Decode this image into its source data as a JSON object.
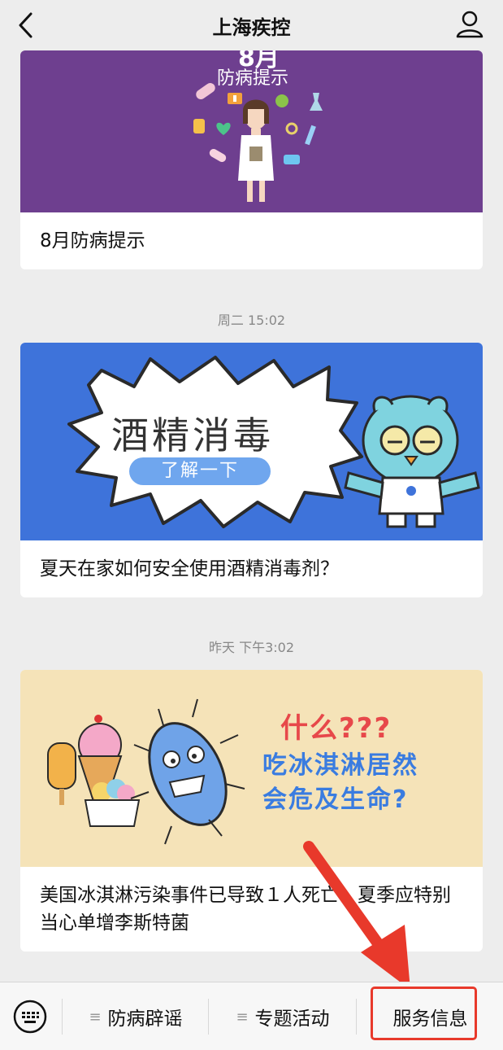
{
  "header": {
    "title": "上海疾控",
    "back_icon": "chevron-left-icon",
    "user_icon": "user-icon"
  },
  "feed": {
    "items": [
      {
        "cover_top_text": "8月",
        "cover_text": "防病提示",
        "cover_color": "#6e3f8f",
        "caption": "8月防病提示"
      },
      {
        "time": "周二 15:02",
        "cover_title": "酒精消毒",
        "cover_button": "了解一下",
        "cover_color": "#3e73da",
        "caption": "夏天在家如何安全使用酒精消毒剂？"
      },
      {
        "time": "昨天 下午3:02",
        "cover_line1": "什么???",
        "cover_line2": "吃冰淇淋居然",
        "cover_line3": "会危及生命?",
        "cover_color": "#f5e3b8",
        "caption": "美国冰淇淋污染事件已导致１人死亡！夏季应特别当心单增李斯特菌"
      }
    ]
  },
  "bottom_bar": {
    "keyboard_icon": "keyboard-icon",
    "menus": [
      {
        "label": "防病辟谣",
        "icon": "menu-lines-icon"
      },
      {
        "label": "专题活动",
        "icon": "menu-lines-icon"
      },
      {
        "label": "服务信息"
      }
    ]
  },
  "colors": {
    "highlight": "#e8392b",
    "background": "#ededed"
  }
}
